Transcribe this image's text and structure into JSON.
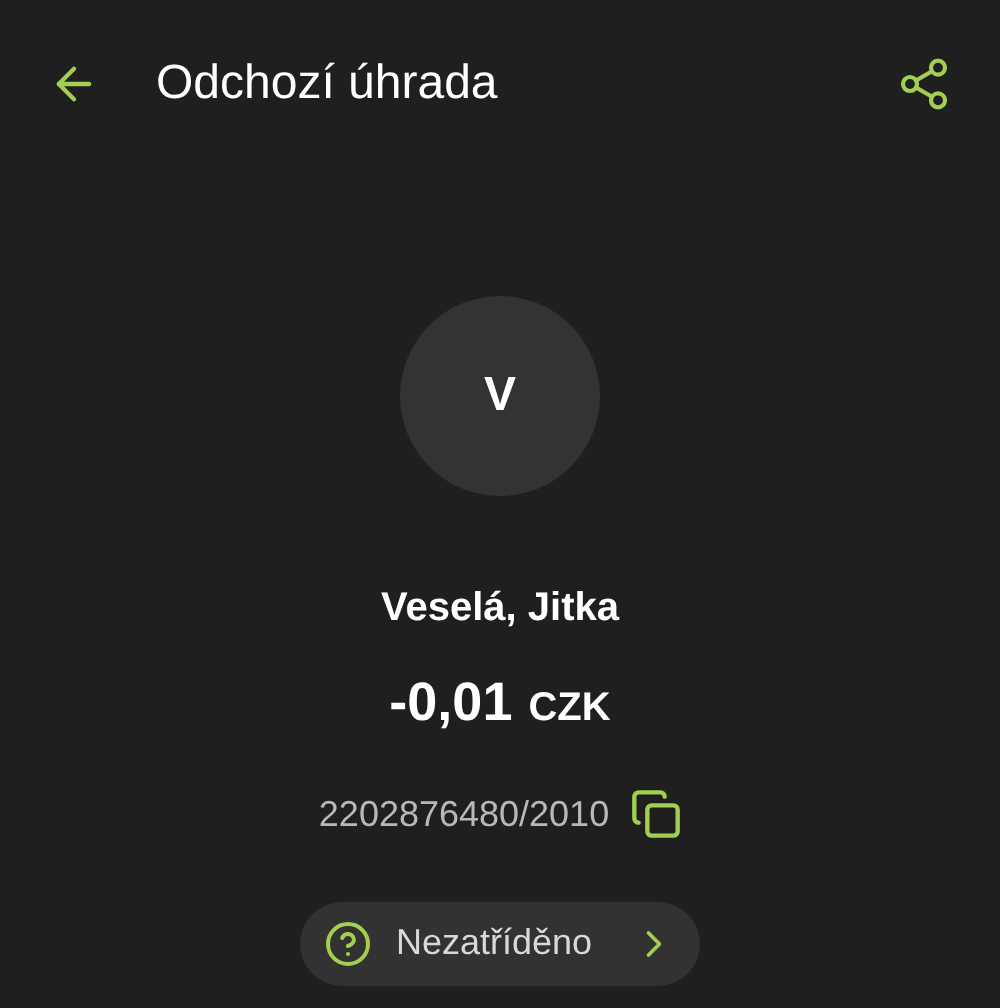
{
  "header": {
    "title": "Odchozí úhrada"
  },
  "avatar": {
    "initial": "V"
  },
  "counterparty": {
    "name": "Veselá, Jitka"
  },
  "amount": {
    "value": "-0,01",
    "currency": "CZK"
  },
  "account": {
    "number": "2202876480/2010"
  },
  "category": {
    "label": "Nezatříděno"
  }
}
